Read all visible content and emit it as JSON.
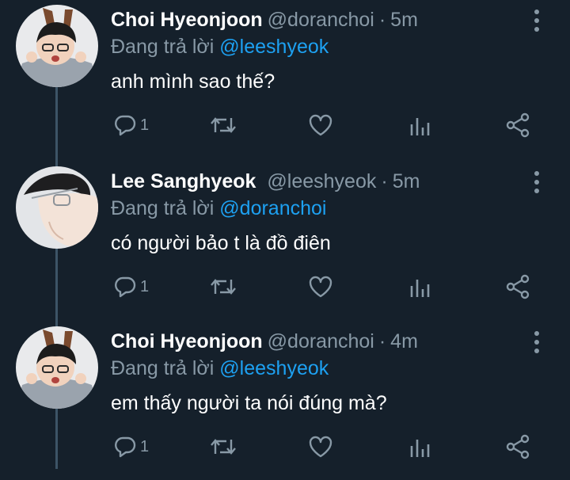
{
  "tweets": [
    {
      "display_name": "Choi Hyeonjoon",
      "handle": "@doranchoi",
      "separator": "·",
      "time": "5m",
      "replying_prefix": "Đang trả lời",
      "replying_to": "@leeshyeok",
      "text": "anh mình sao thế?",
      "reply_count": "1",
      "avatar": "bunny-ears-boy"
    },
    {
      "display_name": "Lee Sanghyeok",
      "handle": "@leeshyeok",
      "separator": "·",
      "time": "5m",
      "replying_prefix": "Đang trả lời",
      "replying_to": "@doranchoi",
      "text": "có người bảo t là đồ điên",
      "reply_count": "1",
      "avatar": "glasses-profile"
    },
    {
      "display_name": "Choi Hyeonjoon",
      "handle": "@doranchoi",
      "separator": "·",
      "time": "4m",
      "replying_prefix": "Đang trả lời",
      "replying_to": "@leeshyeok",
      "text": "em thấy người ta nói đúng mà?",
      "reply_count": "1",
      "avatar": "bunny-ears-boy"
    }
  ],
  "icons": [
    "reply-icon",
    "retweet-icon",
    "like-icon",
    "analytics-icon",
    "share-icon",
    "more-icon"
  ],
  "colors": {
    "background": "#15202b",
    "secondary_text": "#8899a6",
    "mention": "#1da1f2",
    "thread_line": "#3d5466"
  }
}
